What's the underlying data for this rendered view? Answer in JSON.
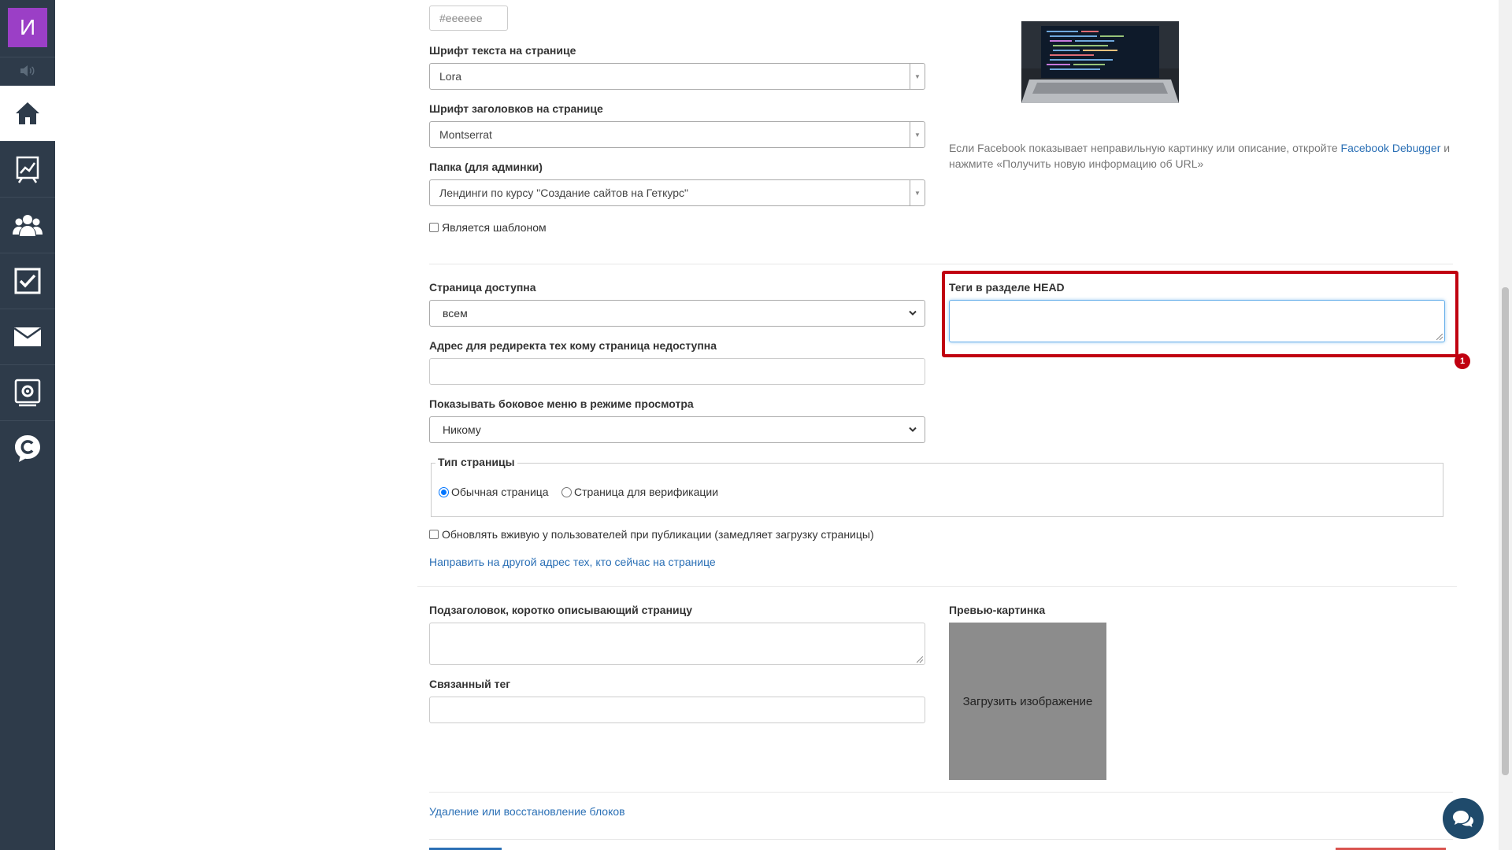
{
  "sidebar": {
    "avatar_letter": "И",
    "avatar_color": "#9b3fc6",
    "background": "#2e3b4a",
    "items": [
      {
        "icon": "home-icon",
        "active": true
      },
      {
        "icon": "chart-icon",
        "active": false
      },
      {
        "icon": "users-icon",
        "active": false
      },
      {
        "icon": "tasks-icon",
        "active": false
      },
      {
        "icon": "mail-icon",
        "active": false
      },
      {
        "icon": "gear-icon",
        "active": false
      },
      {
        "icon": "chat-c-icon",
        "active": false
      }
    ]
  },
  "form": {
    "color_value": "#eeeeee",
    "text_font_label": "Шрифт текста на странице",
    "text_font_value": "Lora",
    "heading_font_label": "Шрифт заголовков на странице",
    "heading_font_value": "Montserrat",
    "folder_label": "Папка (для админки)",
    "folder_value": "Лендинги по курсу \"Создание сайтов на Геткурс\"",
    "is_template_label": "Является шаблоном",
    "available_label": "Страница доступна",
    "available_value": "всем",
    "redirect_label": "Адрес для редиректа тех кому страница недоступна",
    "redirect_value": "",
    "side_menu_label": "Показывать боковое меню в режиме просмотра",
    "side_menu_value": "Никому",
    "page_type_legend": "Тип страницы",
    "page_type_options": [
      "Обычная страница",
      "Страница для верификации"
    ],
    "page_type_selected": "Обычная страница",
    "live_update_label": "Обновлять вживую у пользователей при публикации (замедляет загрузку страницы)",
    "redirect_link": "Направить на другой адрес тех, кто сейчас на странице",
    "subtitle_label": "Подзаголовок, коротко описывающий страницу",
    "linked_tag_label": "Связанный тег",
    "blocks_link": "Удаление или восстановление блоков"
  },
  "right": {
    "fb_hint_before": "Если Facebook показывает неправильную картинку или описание, откройте ",
    "fb_debugger_link": "Facebook Debugger",
    "fb_hint_after": " и нажмите «Получить новую информацию об URL»",
    "head_tags_label": "Теги в разделе HEAD",
    "head_tags_value": "",
    "highlight_badge": "1",
    "preview_label": "Превью-картинка",
    "upload_label": "Загрузить изображение"
  },
  "colors": {
    "link": "#2a6fb5",
    "highlight": "#c00010",
    "chat_button": "#1f4a6b"
  }
}
